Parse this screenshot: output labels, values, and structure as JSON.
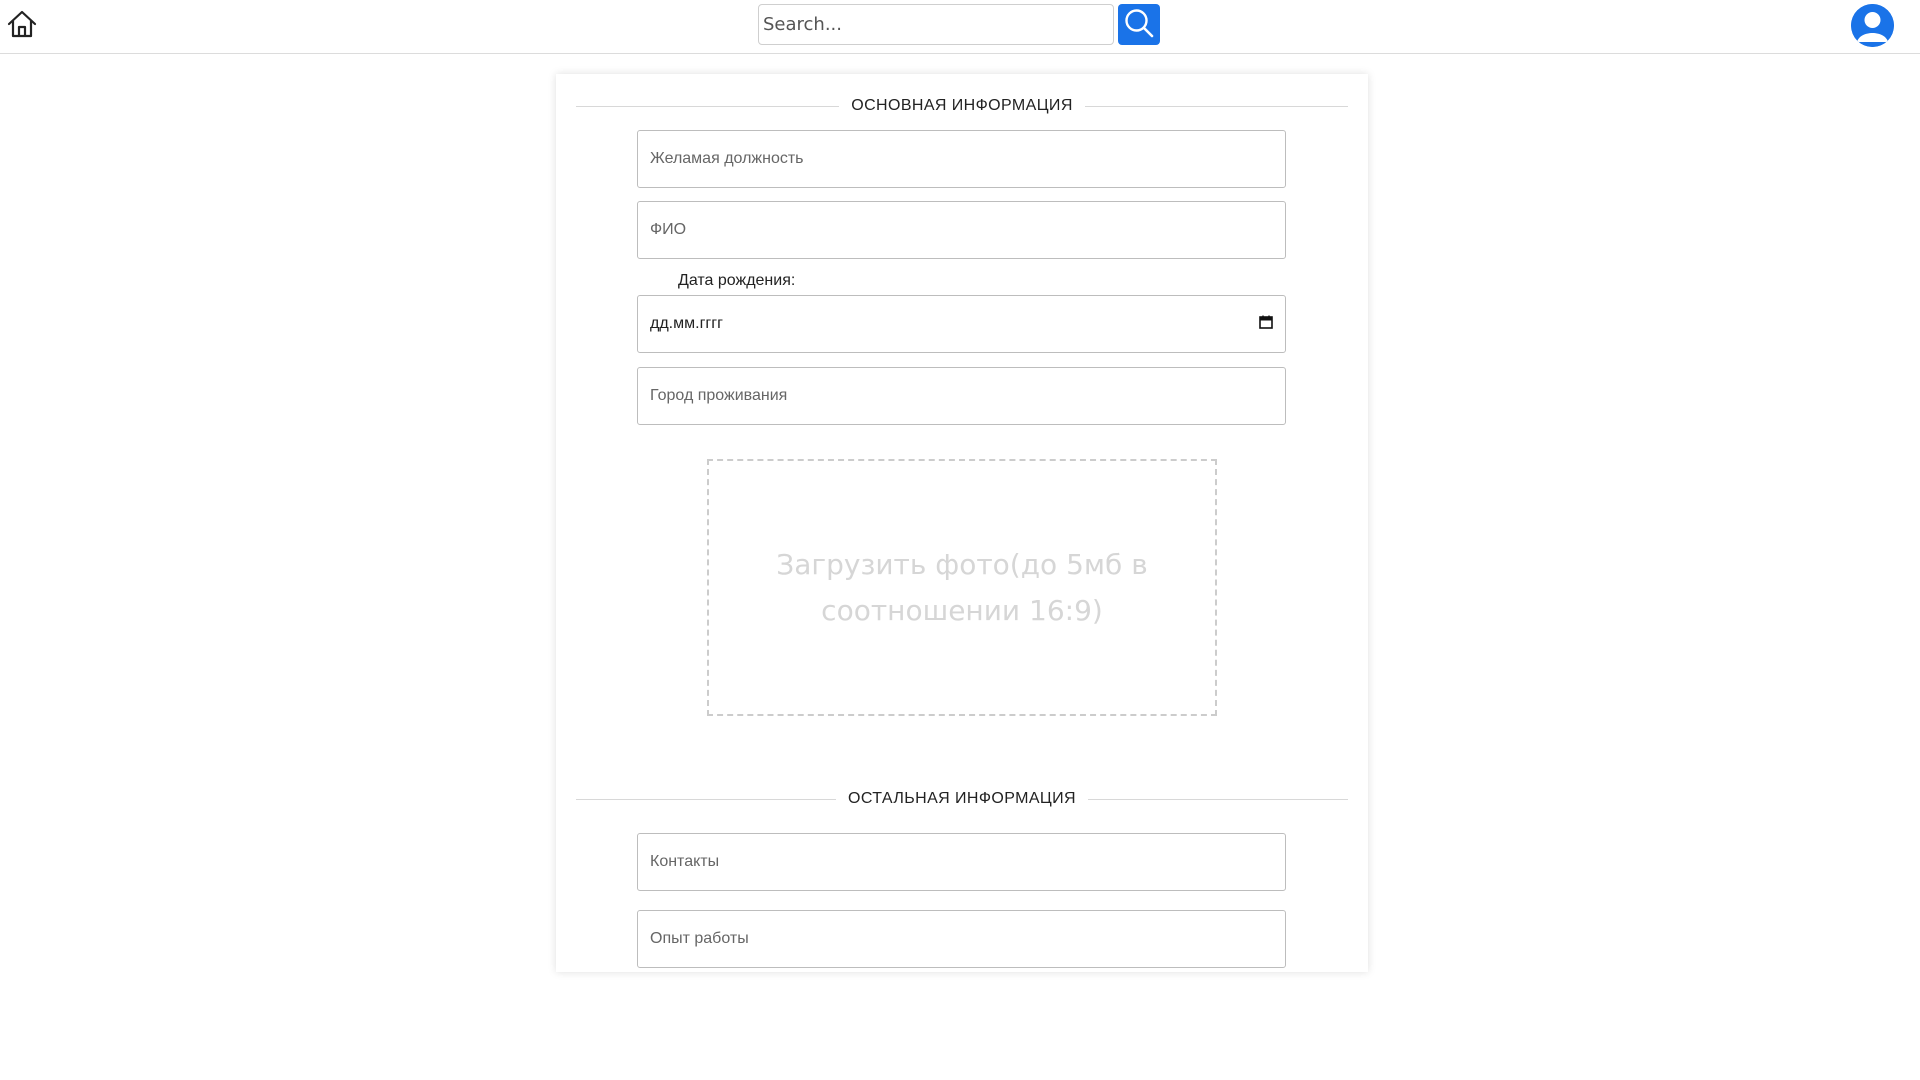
{
  "header": {
    "search_placeholder": "Search..."
  },
  "icons": {
    "home": "home-icon",
    "search": "search-icon",
    "profile": "user-avatar-icon"
  },
  "colors": {
    "accent": "#1a73e8",
    "border": "#bdbdbd",
    "divider": "#d8d8d8",
    "upload_text": "#d6d6d6"
  },
  "form": {
    "section_main_title": "ОСНОВНАЯ ИНФОРМАЦИЯ",
    "position_placeholder": "Желамая должность",
    "fullname_placeholder": "ФИО",
    "birthdate_label": "Дата рождения:",
    "birthdate_value": "дд.мм.гггг",
    "city_placeholder": "Город проживания",
    "upload_text": "Загрузить фото(до 5мб в соотношении 16:9)",
    "section_other_title": "ОСТАЛЬНАЯ ИНФОРМАЦИЯ",
    "contacts_placeholder": "Контакты",
    "experience_placeholder": "Опыт работы"
  }
}
